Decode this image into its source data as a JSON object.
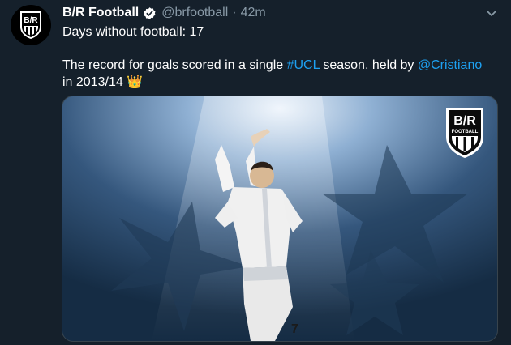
{
  "tweet": {
    "display_name": "B/R Football",
    "handle": "@brfootball",
    "separator": "·",
    "time": "42m",
    "line1": "Days without football: 17",
    "text_before_hashtag": "The record for goals scored in a single ",
    "hashtag": "#UCL",
    "text_mid": " season, held by ",
    "mention": "@Cristiano",
    "text_after": "in 2013/14",
    "emoji": "👑"
  },
  "avatar_logo": {
    "letters": "B/R"
  },
  "image_logo": {
    "letters": "B/R",
    "sub": "FOOTBALL"
  },
  "colors": {
    "background": "#15202b",
    "link": "#1da1f2",
    "muted": "#8899a6"
  },
  "icons": [
    "verified-badge-icon",
    "chevron-down-icon",
    "crown-emoji"
  ]
}
